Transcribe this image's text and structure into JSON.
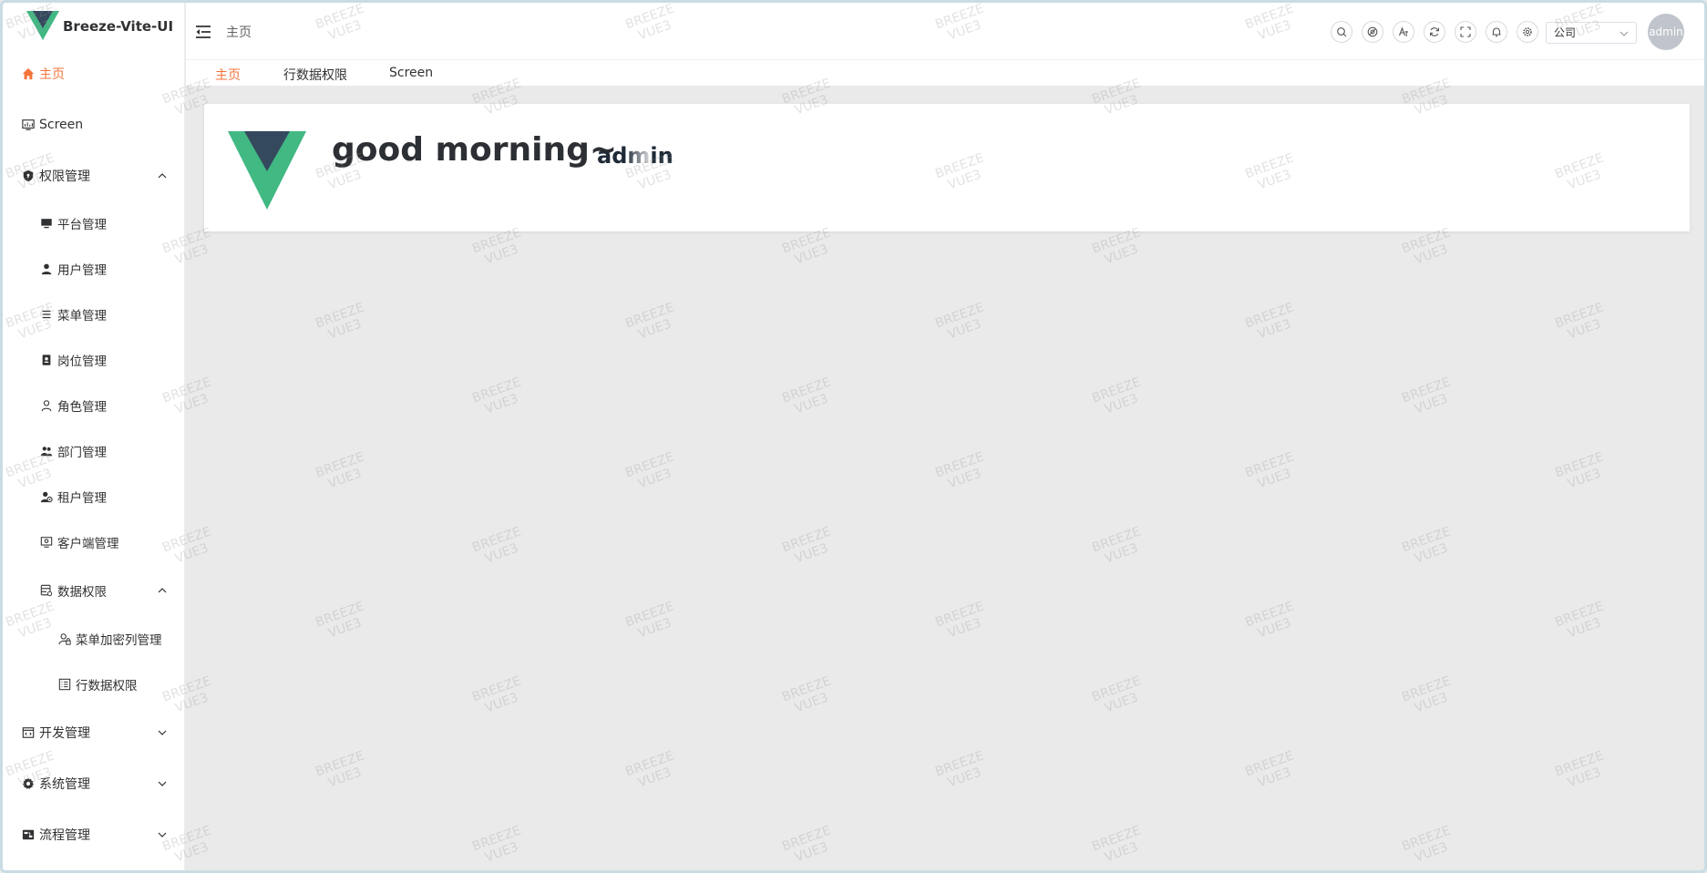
{
  "app": {
    "title": "Breeze-Vite-UI"
  },
  "sidebar": {
    "items": [
      {
        "label": "主页",
        "icon": "home-icon",
        "active": true
      },
      {
        "label": "Screen",
        "icon": "monitor-chart-icon"
      },
      {
        "label": "权限管理",
        "icon": "shield-icon",
        "expanded": true
      },
      {
        "label": "平台管理",
        "icon": "desktop-icon"
      },
      {
        "label": "用户管理",
        "icon": "user-icon"
      },
      {
        "label": "菜单管理",
        "icon": "menu-list-icon"
      },
      {
        "label": "岗位管理",
        "icon": "badge-icon"
      },
      {
        "label": "角色管理",
        "icon": "user-outline-icon"
      },
      {
        "label": "部门管理",
        "icon": "users-icon"
      },
      {
        "label": "租户管理",
        "icon": "user-gear-icon"
      },
      {
        "label": "客户端管理",
        "icon": "client-icon"
      },
      {
        "label": "数据权限",
        "icon": "database-icon",
        "expanded": true
      },
      {
        "label": "菜单加密列管理",
        "icon": "user-lock-icon"
      },
      {
        "label": "行数据权限",
        "icon": "list-doc-icon"
      },
      {
        "label": "开发管理",
        "icon": "code-window-icon",
        "expanded": false
      },
      {
        "label": "系统管理",
        "icon": "gear-icon",
        "expanded": false
      },
      {
        "label": "流程管理",
        "icon": "flow-icon",
        "expanded": false
      }
    ]
  },
  "header": {
    "breadcrumb": "主页",
    "tools": [
      "search-icon",
      "theme-icon",
      "translate-icon",
      "refresh-icon",
      "fullscreen-icon",
      "bell-icon",
      "settings-icon"
    ],
    "tenant_select": "公司",
    "avatar_text": "admin"
  },
  "tabs": [
    {
      "label": "主页",
      "active": true
    },
    {
      "label": "行数据权限"
    },
    {
      "label": "Screen"
    }
  ],
  "welcome": {
    "greeting": "good morning~",
    "user": "admin"
  },
  "watermark": {
    "line1": "BREEZE",
    "line2": "VUE3"
  },
  "colors": {
    "accent": "#f4743b",
    "vue_green": "#42b883",
    "vue_dark": "#35495e"
  }
}
